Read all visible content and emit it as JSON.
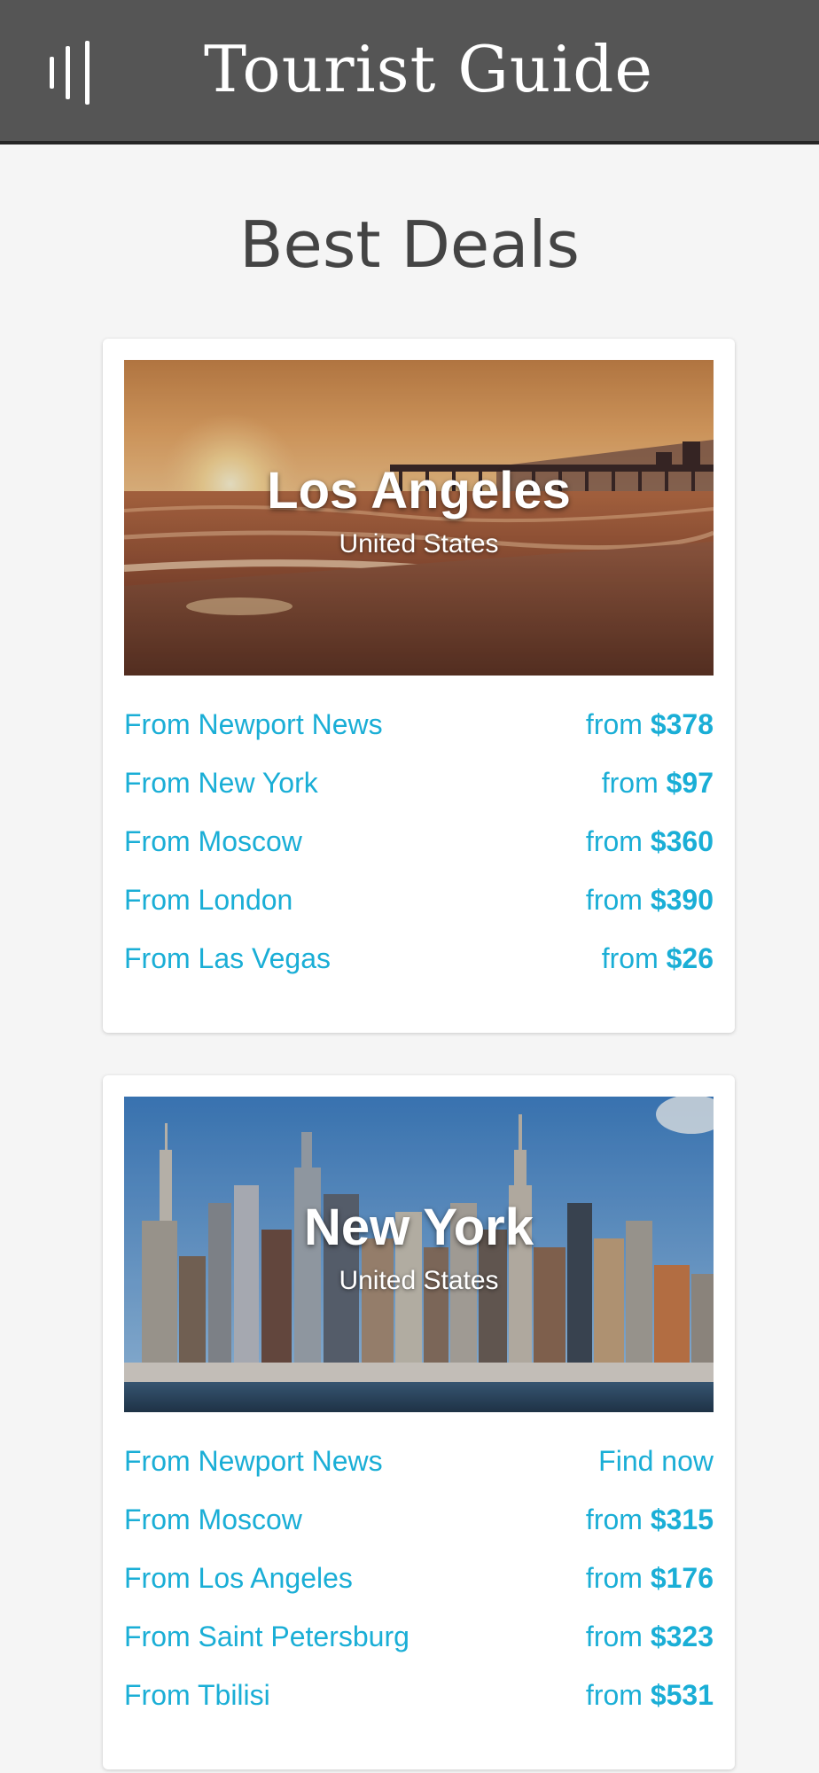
{
  "header": {
    "title": "Tourist Guide",
    "menu_icon": "menu-bars-icon",
    "background": "#555555"
  },
  "page": {
    "heading": "Best Deals",
    "link_color": "#1aaed6"
  },
  "cards": [
    {
      "city": "Los Angeles",
      "country": "United States",
      "image": "beach-sunset-pier",
      "deals": [
        {
          "origin": "From Newport News",
          "prefix": "from",
          "price": "$378"
        },
        {
          "origin": "From New York",
          "prefix": "from",
          "price": "$97"
        },
        {
          "origin": "From Moscow",
          "prefix": "from",
          "price": "$360"
        },
        {
          "origin": "From London",
          "prefix": "from",
          "price": "$390"
        },
        {
          "origin": "From Las Vegas",
          "prefix": "from",
          "price": "$26"
        }
      ]
    },
    {
      "city": "New York",
      "country": "United States",
      "image": "city-skyline",
      "deals": [
        {
          "origin": "From Newport News",
          "prefix": "",
          "price": "",
          "action": "Find now"
        },
        {
          "origin": "From Moscow",
          "prefix": "from",
          "price": "$315"
        },
        {
          "origin": "From Los Angeles",
          "prefix": "from",
          "price": "$176"
        },
        {
          "origin": "From Saint Petersburg",
          "prefix": "from",
          "price": "$323"
        },
        {
          "origin": "From Tbilisi",
          "prefix": "from",
          "price": "$531"
        }
      ]
    }
  ]
}
